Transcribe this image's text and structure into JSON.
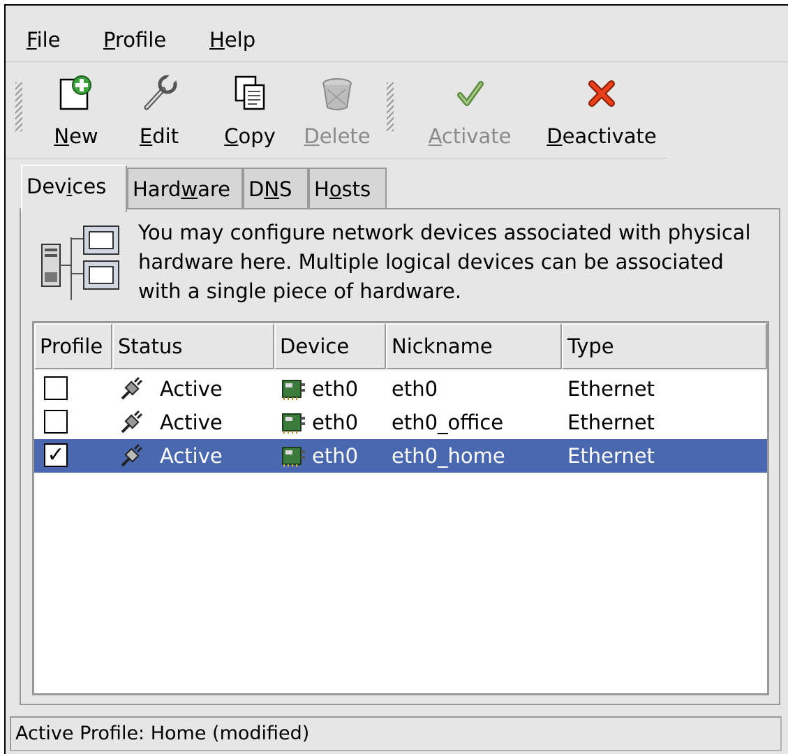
{
  "menubar": {
    "file": {
      "label": "File",
      "mnemonic": "F",
      "rest": "ile"
    },
    "profile": {
      "label": "Profile",
      "mnemonic": "P",
      "rest": "rofile"
    },
    "help": {
      "label": "Help",
      "mnemonic": "H",
      "rest": "elp"
    }
  },
  "toolbar": {
    "new": {
      "pre": "",
      "mn": "N",
      "post": "ew",
      "icon": "new-icon"
    },
    "edit": {
      "pre": "",
      "mn": "E",
      "post": "dit",
      "icon": "edit-wrench-icon"
    },
    "copy": {
      "pre": "",
      "mn": "C",
      "post": "opy",
      "icon": "copy-icon"
    },
    "delete": {
      "pre": "",
      "mn": "D",
      "post": "elete",
      "icon": "trash-icon",
      "enabled": false
    },
    "activate": {
      "pre": "",
      "mn": "A",
      "post": "ctivate",
      "icon": "checkmark-icon",
      "enabled": false
    },
    "deactivate": {
      "pre": "",
      "mn": "D",
      "post": "eactivate",
      "icon": "red-x-icon"
    }
  },
  "tabs": [
    {
      "pre": "Dev",
      "mn": "i",
      "post": "ces",
      "active": true
    },
    {
      "pre": "Hard",
      "mn": "w",
      "post": "are",
      "active": false
    },
    {
      "pre": "D",
      "mn": "N",
      "post": "S",
      "active": false
    },
    {
      "pre": "H",
      "mn": "o",
      "post": "sts",
      "active": false
    }
  ],
  "devices_tab": {
    "info_text": "You may configure network devices associated with physical hardware here.  Multiple logical devices can be associated with a single piece of hardware.",
    "columns": [
      "Profile",
      "Status",
      "Device",
      "Nickname",
      "Type"
    ],
    "rows": [
      {
        "profile_checked": false,
        "status": "Active",
        "device": "eth0",
        "nickname": "eth0",
        "type": "Ethernet",
        "selected": false
      },
      {
        "profile_checked": false,
        "status": "Active",
        "device": "eth0",
        "nickname": "eth0_office",
        "type": "Ethernet",
        "selected": false
      },
      {
        "profile_checked": true,
        "status": "Active",
        "device": "eth0",
        "nickname": "eth0_home",
        "type": "Ethernet",
        "selected": true
      }
    ]
  },
  "statusbar": {
    "text": "Active Profile: Home (modified)"
  },
  "colors": {
    "window_bg": "#e6e6e6",
    "selection": "#4a68b0"
  }
}
